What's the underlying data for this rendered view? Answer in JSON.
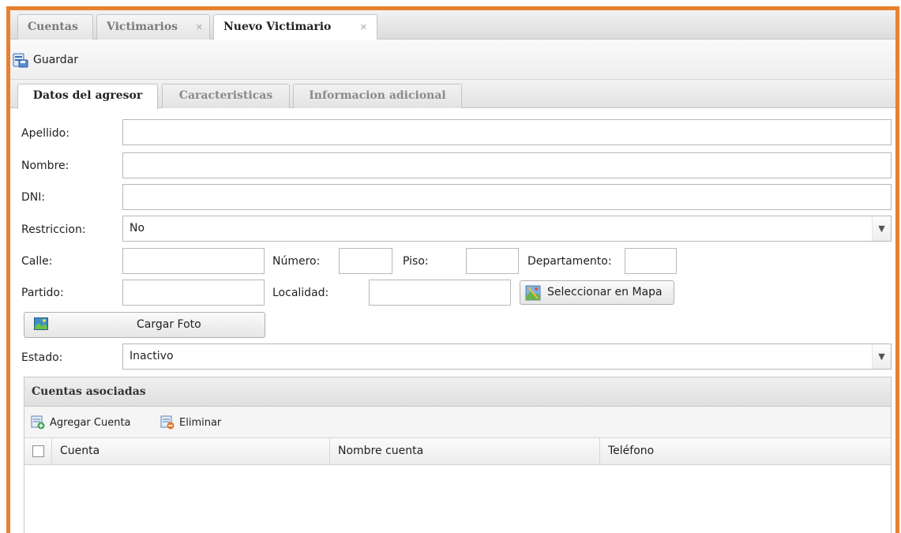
{
  "top_tabs": [
    {
      "label": "Cuentas",
      "active": false
    },
    {
      "label": "Victimarios",
      "active": false,
      "closable": true
    },
    {
      "label": "Nuevo Victimario",
      "active": true,
      "closable": true
    }
  ],
  "close_glyph": "✕",
  "toolbar": {
    "save_label": "Guardar"
  },
  "inner_tabs": [
    {
      "label": "Datos del agresor",
      "active": true
    },
    {
      "label": "Caracteristicas",
      "active": false
    },
    {
      "label": "Informacion adicional",
      "active": false
    }
  ],
  "form": {
    "apellido_label": "Apellido:",
    "apellido_value": "",
    "nombre_label": "Nombre:",
    "nombre_value": "",
    "dni_label": "DNI:",
    "dni_value": "",
    "restriccion_label": "Restriccion:",
    "restriccion_value": "No",
    "calle_label": "Calle:",
    "calle_value": "",
    "numero_label": "Número:",
    "numero_value": "",
    "piso_label": "Piso:",
    "piso_value": "",
    "departamento_label": "Departamento:",
    "departamento_value": "",
    "partido_label": "Partido:",
    "partido_value": "",
    "localidad_label": "Localidad:",
    "localidad_value": "",
    "map_button_label": "Seleccionar en Mapa",
    "photo_button_label": "Cargar Foto",
    "estado_label": "Estado:",
    "estado_value": "Inactivo"
  },
  "accounts_panel": {
    "title": "Cuentas asociadas",
    "add_label": "Agregar Cuenta",
    "delete_label": "Eliminar",
    "columns": [
      "Cuenta",
      "Nombre cuenta",
      "Teléfono"
    ],
    "rows": []
  },
  "icons": {
    "save": "save-icon",
    "map": "map-icon",
    "photo": "picture-icon",
    "add": "add-record-icon",
    "delete": "delete-record-icon",
    "dropdown": "chevron-down-icon"
  },
  "colors": {
    "frame_border": "#e8812f"
  }
}
